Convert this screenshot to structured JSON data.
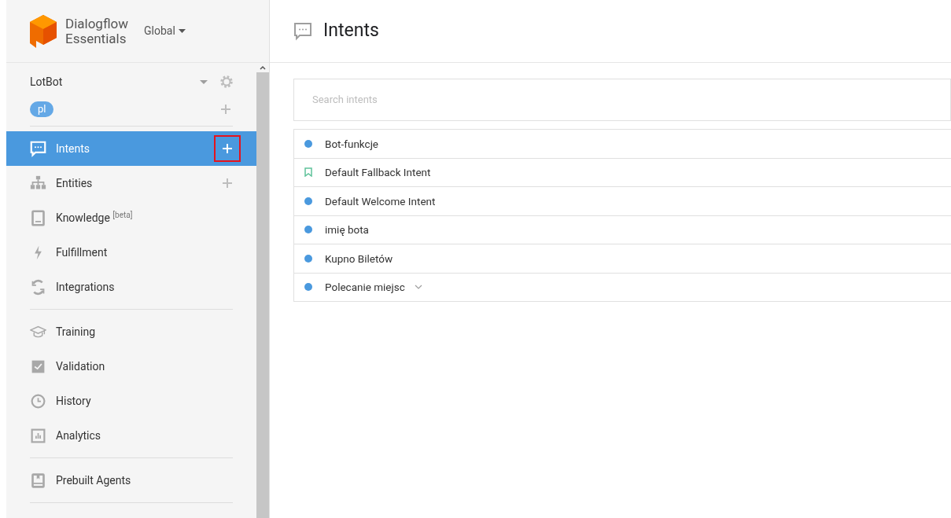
{
  "brand": {
    "line_1": "Dialogflow",
    "line_2": "Essentials",
    "region": "Global"
  },
  "agent": {
    "name": "LotBot",
    "language": "pl"
  },
  "sidebar": {
    "sections": [
      [
        {
          "label": "Intents",
          "selected": true,
          "addable": true,
          "highlighted": true
        },
        {
          "label": "Entities",
          "selected": false,
          "addable": true,
          "highlighted": false
        },
        {
          "label": "Knowledge $^{[beta]}$",
          "selected": false,
          "addable": false,
          "highlighted": false
        },
        {
          "label": "Fulfillment",
          "selected": false,
          "addable": false,
          "highlighted": false
        },
        {
          "label": "Integrations",
          "selected": false,
          "addable": false,
          "highlighted": false
        }
      ],
      [
        {
          "label": "Training",
          "selected": false,
          "addable": false,
          "highlighted": false
        },
        {
          "label": "Validation",
          "selected": false,
          "addable": false,
          "highlighted": false
        },
        {
          "label": "History",
          "selected": false,
          "addable": false,
          "highlighted": false
        },
        {
          "label": "Analytics",
          "selected": false,
          "addable": false,
          "highlighted": false
        }
      ],
      [
        {
          "label": "Prebuilt Agents",
          "selected": false,
          "addable": false,
          "highlighted": false
        }
      ]
    ]
  },
  "page": {
    "title": "Intents",
    "search": {
      "placeholder": "Search intents"
    },
    "intents": [
      {
        "name": "Bot-funkcje",
        "kind": "regular",
        "expandable": false
      },
      {
        "name": "Default Fallback Intent",
        "kind": "fallback",
        "expandable": false
      },
      {
        "name": "Default Welcome Intent",
        "kind": "regular",
        "expandable": false
      },
      {
        "name": "imię bota",
        "kind": "regular",
        "expandable": false
      },
      {
        "name": "Kupno Biletów",
        "kind": "regular",
        "expandable": false
      },
      {
        "name": "Polecanie miejsc",
        "kind": "regular",
        "expandable": true
      }
    ]
  }
}
